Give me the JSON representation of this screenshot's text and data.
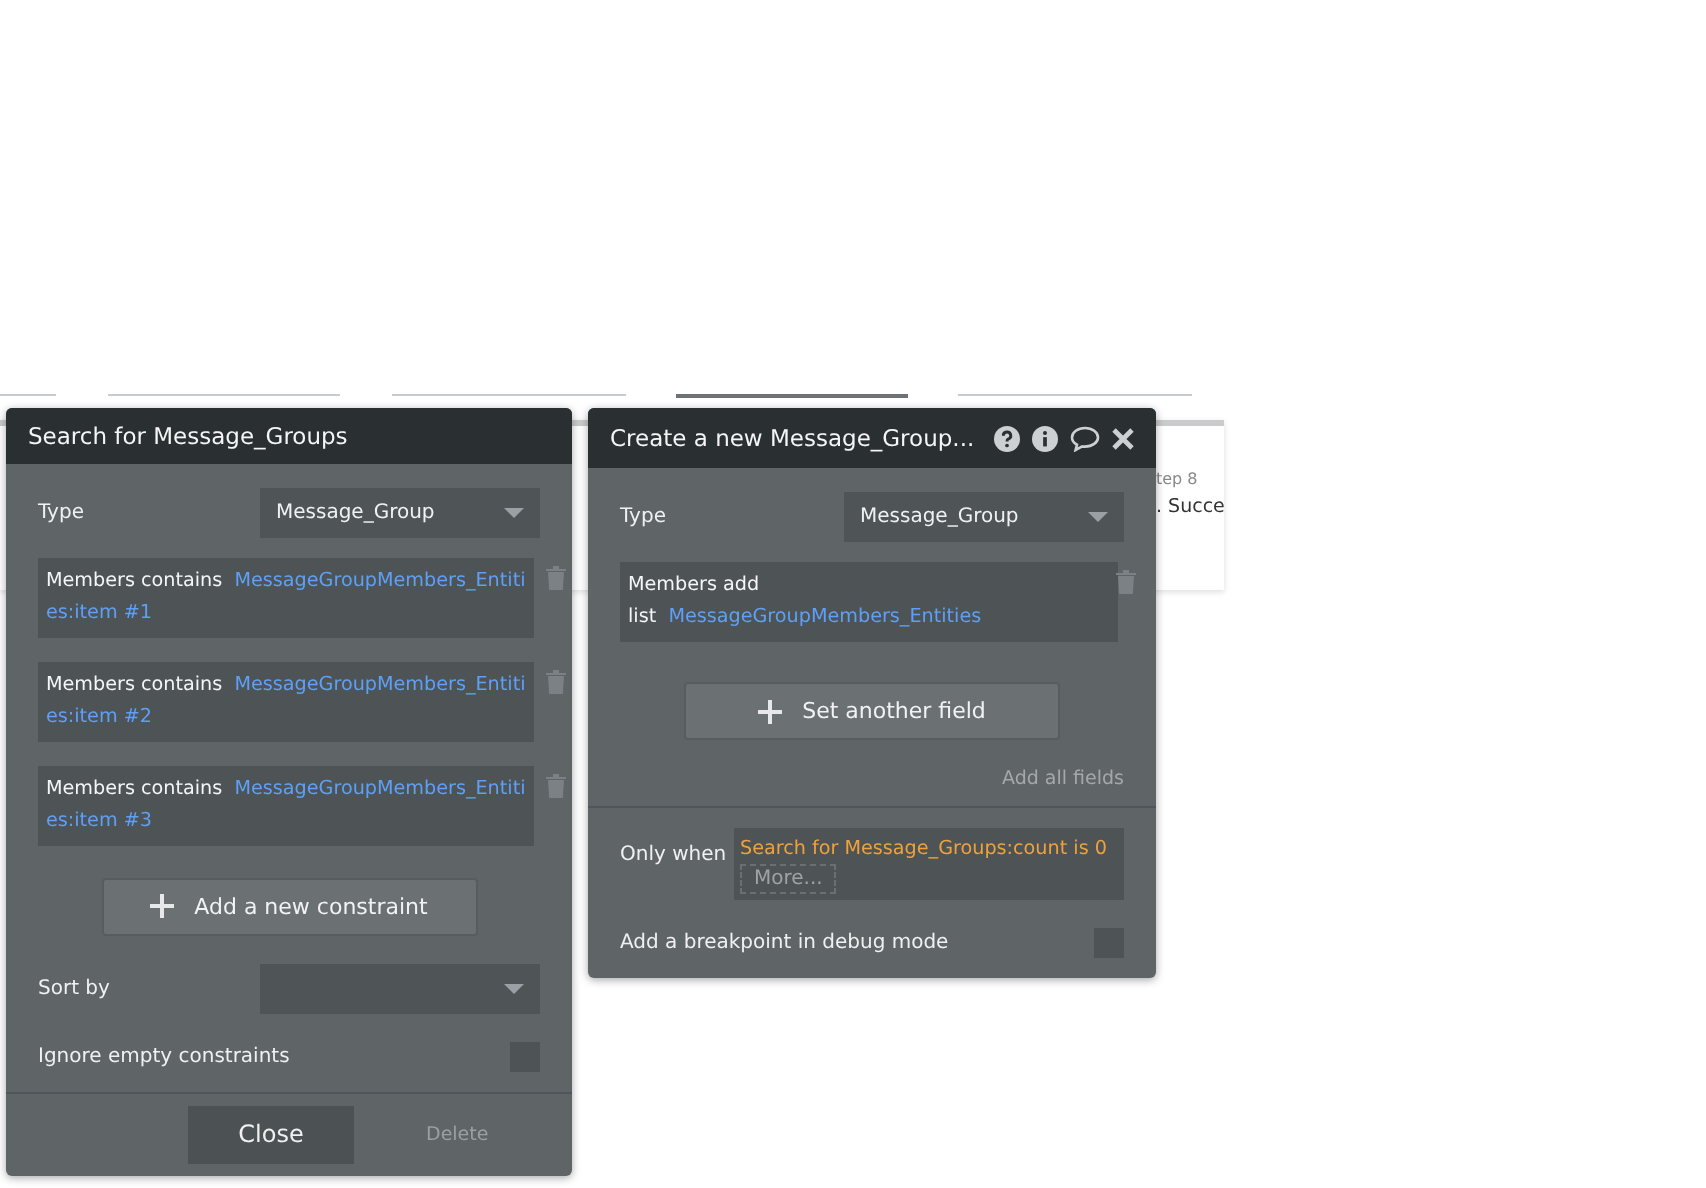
{
  "background": {
    "step_label": "tep 8",
    "step_text": ". Succe",
    "tabs": [
      {
        "selected": false
      },
      {
        "selected": false
      },
      {
        "selected": false
      },
      {
        "selected": true
      },
      {
        "selected": false
      }
    ]
  },
  "search_panel": {
    "title": "Search for Message_Groups",
    "type_label": "Type",
    "type_value": "Message_Group",
    "constraints": [
      {
        "label": "Members contains",
        "value": "MessageGroupMembers_Entities:item #1"
      },
      {
        "label": "Members contains",
        "value": "MessageGroupMembers_Entities:item #2"
      },
      {
        "label": "Members contains",
        "value": "MessageGroupMembers_Entities:item #3"
      }
    ],
    "add_button": "Add a new constraint",
    "sort_label": "Sort by",
    "ignore_label": "Ignore empty constraints",
    "ignore_checked": false,
    "close_button": "Close",
    "delete_button": "Delete"
  },
  "action_panel": {
    "title": "Create a new Message_Group...",
    "type_label": "Type",
    "type_value": "Message_Group",
    "fields": [
      {
        "label": "Members add",
        "prefix": "list",
        "value": "MessageGroupMembers_Entities"
      }
    ],
    "set_button": "Set another field",
    "add_all": "Add all fields",
    "only_when_label": "Only when",
    "condition": "Search for Message_Groups:count is 0",
    "more": "More...",
    "breakpoint_label": "Add a breakpoint in debug mode",
    "breakpoint_checked": false
  }
}
